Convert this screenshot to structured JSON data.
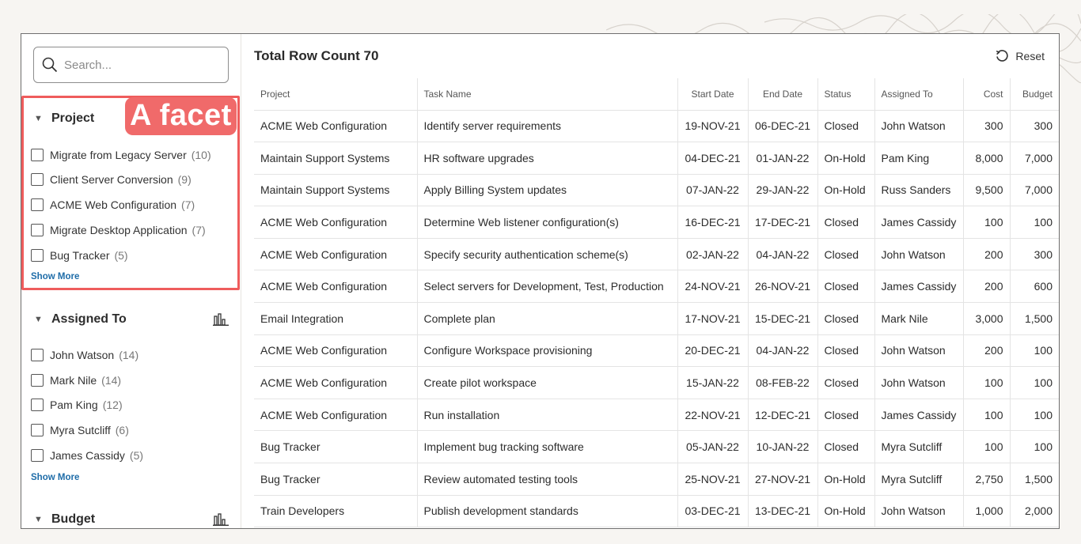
{
  "search": {
    "placeholder": "Search..."
  },
  "callout": {
    "text": "A facet"
  },
  "facets": [
    {
      "title": "Project",
      "options": [
        {
          "label": "Migrate from Legacy Server",
          "count": "(10)"
        },
        {
          "label": "Client Server Conversion",
          "count": "(9)"
        },
        {
          "label": "ACME Web Configuration",
          "count": "(7)"
        },
        {
          "label": "Migrate Desktop Application",
          "count": "(7)"
        },
        {
          "label": "Bug Tracker",
          "count": "(5)"
        }
      ],
      "show_more": "Show More"
    },
    {
      "title": "Assigned To",
      "options": [
        {
          "label": "John Watson",
          "count": "(14)"
        },
        {
          "label": "Mark Nile",
          "count": "(14)"
        },
        {
          "label": "Pam King",
          "count": "(12)"
        },
        {
          "label": "Myra Sutcliff",
          "count": "(6)"
        },
        {
          "label": "James Cassidy",
          "count": "(5)"
        }
      ],
      "show_more": "Show More"
    },
    {
      "title": "Budget"
    }
  ],
  "toolbar": {
    "row_count": "Total Row Count 70",
    "reset_label": "Reset"
  },
  "table": {
    "columns": [
      "Project",
      "Task Name",
      "Start Date",
      "End Date",
      "Status",
      "Assigned To",
      "Cost",
      "Budget"
    ],
    "rows": [
      [
        "ACME Web Configuration",
        "Identify server requirements",
        "19-NOV-21",
        "06-DEC-21",
        "Closed",
        "John Watson",
        "300",
        "300"
      ],
      [
        "Maintain Support Systems",
        "HR software upgrades",
        "04-DEC-21",
        "01-JAN-22",
        "On-Hold",
        "Pam King",
        "8,000",
        "7,000"
      ],
      [
        "Maintain Support Systems",
        "Apply Billing System updates",
        "07-JAN-22",
        "29-JAN-22",
        "On-Hold",
        "Russ Sanders",
        "9,500",
        "7,000"
      ],
      [
        "ACME Web Configuration",
        "Determine Web listener configuration(s)",
        "16-DEC-21",
        "17-DEC-21",
        "Closed",
        "James Cassidy",
        "100",
        "100"
      ],
      [
        "ACME Web Configuration",
        "Specify security authentication scheme(s)",
        "02-JAN-22",
        "04-JAN-22",
        "Closed",
        "John Watson",
        "200",
        "300"
      ],
      [
        "ACME Web Configuration",
        "Select servers for Development, Test, Production",
        "24-NOV-21",
        "26-NOV-21",
        "Closed",
        "James Cassidy",
        "200",
        "600"
      ],
      [
        "Email Integration",
        "Complete plan",
        "17-NOV-21",
        "15-DEC-21",
        "Closed",
        "Mark Nile",
        "3,000",
        "1,500"
      ],
      [
        "ACME Web Configuration",
        "Configure Workspace provisioning",
        "20-DEC-21",
        "04-JAN-22",
        "Closed",
        "John Watson",
        "200",
        "100"
      ],
      [
        "ACME Web Configuration",
        "Create pilot workspace",
        "15-JAN-22",
        "08-FEB-22",
        "Closed",
        "John Watson",
        "100",
        "100"
      ],
      [
        "ACME Web Configuration",
        "Run installation",
        "22-NOV-21",
        "12-DEC-21",
        "Closed",
        "James Cassidy",
        "100",
        "100"
      ],
      [
        "Bug Tracker",
        "Implement bug tracking software",
        "05-JAN-22",
        "10-JAN-22",
        "Closed",
        "Myra Sutcliff",
        "100",
        "100"
      ],
      [
        "Bug Tracker",
        "Review automated testing tools",
        "25-NOV-21",
        "27-NOV-21",
        "On-Hold",
        "Myra Sutcliff",
        "2,750",
        "1,500"
      ],
      [
        "Train Developers",
        "Publish development standards",
        "03-DEC-21",
        "13-DEC-21",
        "On-Hold",
        "John Watson",
        "1,000",
        "2,000"
      ]
    ]
  },
  "colors": {
    "highlight": "#ef5c5c",
    "link": "#1e6ca8"
  }
}
